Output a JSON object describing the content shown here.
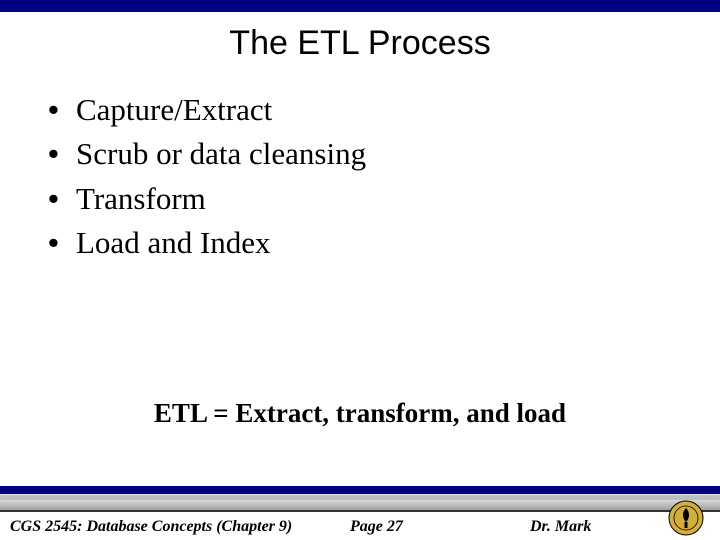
{
  "slide": {
    "title": "The ETL Process",
    "bullets": [
      "Capture/Extract",
      "Scrub or data cleansing",
      "Transform",
      "Load and Index"
    ],
    "summary": "ETL = Extract, transform, and load"
  },
  "footer": {
    "course": "CGS 2545: Database Concepts  (Chapter 9)",
    "page": "Page 27",
    "author": "Dr. Mark"
  }
}
